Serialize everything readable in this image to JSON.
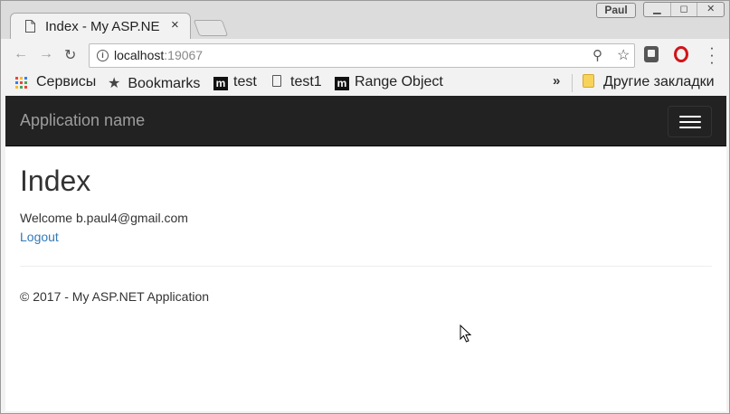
{
  "browser": {
    "tab_title": "Index - My ASP.NE",
    "tab_close": "×",
    "profile_name": "Paul",
    "url_host": "localhost",
    "url_port": ":19067"
  },
  "bookmarks": {
    "apps_label": "Сервисы",
    "items": [
      {
        "label": "Bookmarks",
        "icon": "star-icon"
      },
      {
        "label": "test",
        "icon": "m-icon"
      },
      {
        "label": "test1",
        "icon": "page-icon"
      },
      {
        "label": "Range Object",
        "icon": "m-icon"
      }
    ],
    "overflow": "»",
    "other_label": "Другие закладки"
  },
  "app": {
    "brand": "Application name",
    "title": "Index",
    "welcome": "Welcome b.paul4@gmail.com",
    "logout": "Logout",
    "footer": "© 2017 - My ASP.NET Application"
  },
  "colors": {
    "navbar_bg": "#222222",
    "link": "#337ab7",
    "brand_text": "#9d9d9d"
  }
}
